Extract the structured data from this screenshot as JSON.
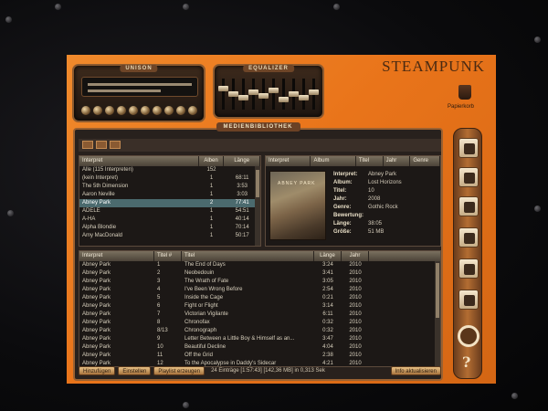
{
  "app": {
    "brand": "STEAMPUNK"
  },
  "panels": {
    "unison": "UNISON",
    "equalizer": "EQUALIZER"
  },
  "library": {
    "title": "MEDIENBIBLIOTHEK",
    "artists": {
      "headers": [
        "Interpret",
        "Alben",
        "Länge"
      ],
      "rows": [
        [
          "Alle (115 Interpreten)",
          "152",
          ""
        ],
        [
          "(kein Interpret)",
          "1",
          "68:11"
        ],
        [
          "The 5th Dimension",
          "1",
          "3:53"
        ],
        [
          "Aaron Neville",
          "1",
          "3:03"
        ],
        [
          "Abney Park",
          "2",
          "77:41"
        ],
        [
          "ADELE",
          "1",
          "54:51"
        ],
        [
          "A-HA",
          "1",
          "40:14"
        ],
        [
          "Alpha Blondie",
          "1",
          "70:14"
        ],
        [
          "Amy MacDonald",
          "1",
          "50:17"
        ]
      ],
      "selected_index": 4
    },
    "info": {
      "headers": [
        "Interpret",
        "Album",
        "Titel",
        "Jahr",
        "Genre"
      ],
      "cover_text": "ABNEY PARK",
      "fields": [
        {
          "k": "Interpret:",
          "v": "Abney Park"
        },
        {
          "k": "Album:",
          "v": "Lost Horizons"
        },
        {
          "k": "Titel:",
          "v": "10"
        },
        {
          "k": "Jahr:",
          "v": "2008"
        },
        {
          "k": "Genre:",
          "v": "Gothic Rock"
        },
        {
          "k": "Bewertung:",
          "v": ""
        },
        {
          "k": "Länge:",
          "v": "38:05"
        },
        {
          "k": "Größe:",
          "v": "51 MB"
        }
      ]
    },
    "tracks": {
      "headers": [
        "Interpret",
        "Titel #",
        "Titel",
        "Länge",
        "Jahr"
      ],
      "rows": [
        [
          "Abney Park",
          "1",
          "The End of Days",
          "3:24",
          "2010"
        ],
        [
          "Abney Park",
          "2",
          "Neobedouin",
          "3:41",
          "2010"
        ],
        [
          "Abney Park",
          "3",
          "The Wrath of Fate",
          "3:05",
          "2010"
        ],
        [
          "Abney Park",
          "4",
          "I've Been Wrong Before",
          "2:54",
          "2010"
        ],
        [
          "Abney Park",
          "5",
          "Inside the Cage",
          "0:21",
          "2010"
        ],
        [
          "Abney Park",
          "6",
          "Fight or Flight",
          "3:14",
          "2010"
        ],
        [
          "Abney Park",
          "7",
          "Victorian Vigilante",
          "6:11",
          "2010"
        ],
        [
          "Abney Park",
          "8",
          "Chronofax",
          "0:32",
          "2010"
        ],
        [
          "Abney Park",
          "8/13",
          "Chronograph",
          "0:32",
          "2010"
        ],
        [
          "Abney Park",
          "9",
          "Letter Between a Little Boy & Himself as an...",
          "3:47",
          "2010"
        ],
        [
          "Abney Park",
          "10",
          "Beautiful Decline",
          "4:04",
          "2010"
        ],
        [
          "Abney Park",
          "11",
          "Off the Grid",
          "2:38",
          "2010"
        ],
        [
          "Abney Park",
          "12",
          "To the Apocalypse in Daddy's Sidecar",
          "4:21",
          "2010"
        ]
      ]
    },
    "status": {
      "btn_add": "Hinzufügen",
      "btn_settings": "Einstellen",
      "btn_playlist": "Playlist erzeugen",
      "summary": "24 Einträge [1:57:43] [142,36 MB] in 0,313 Sek",
      "btn_info": "Info aktualisieren"
    }
  },
  "dock": {
    "trash_label": "Papierkorb"
  },
  "theme": {
    "accent": "#e9741a",
    "panel_border": "#9a6131",
    "selection": "#4b6a6e"
  }
}
